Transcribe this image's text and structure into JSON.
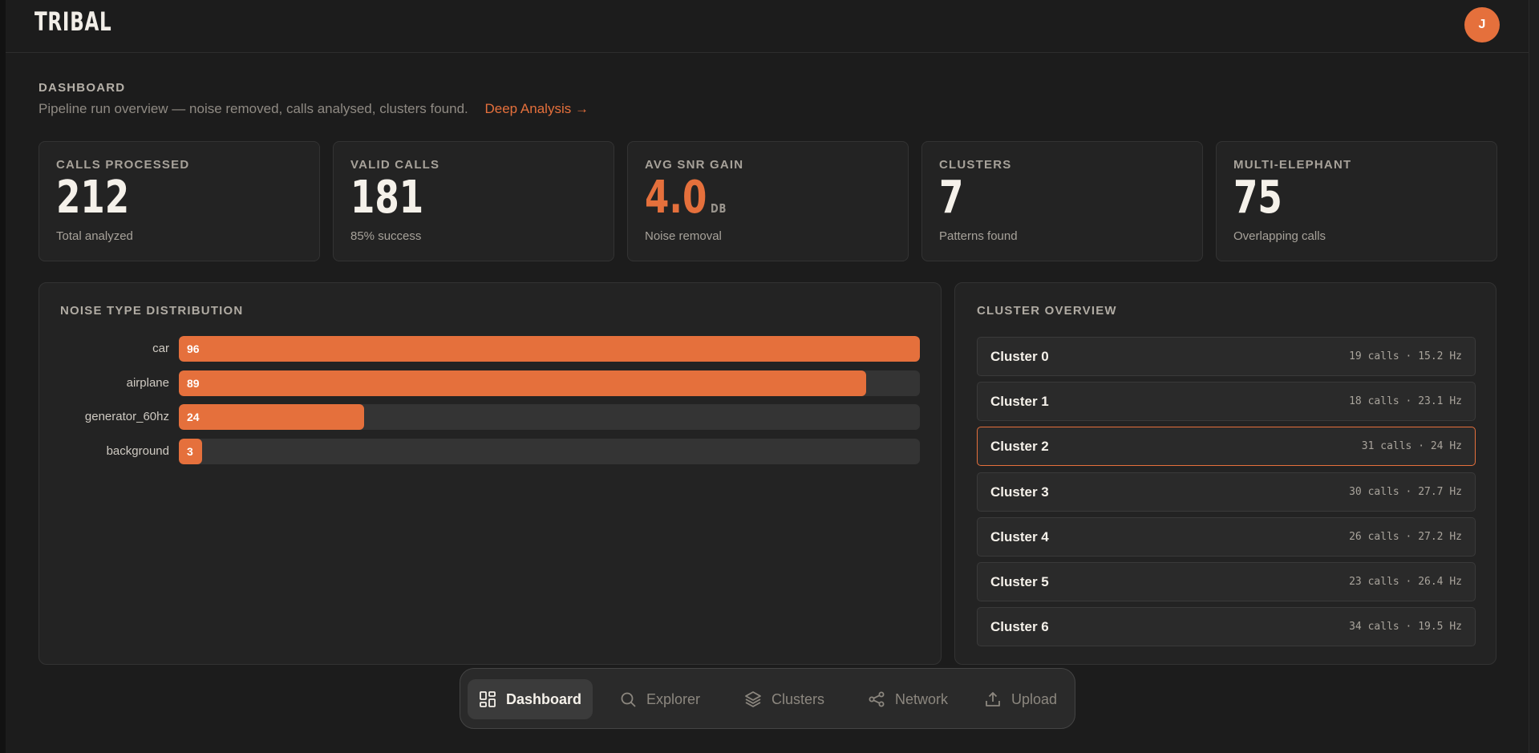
{
  "brand": {
    "name": "TRIBAL",
    "avatar_initial": "J"
  },
  "header": {
    "eyebrow": "DASHBOARD",
    "subtitle": "Pipeline run overview — noise removed, calls analysed, clusters found.",
    "deep_link": "Deep Analysis →"
  },
  "stats": [
    {
      "label": "CALLS PROCESSED",
      "value": "212",
      "unit": "",
      "caption": "Total analyzed"
    },
    {
      "label": "VALID CALLS",
      "value": "181",
      "unit": "",
      "caption": "85% success"
    },
    {
      "label": "AVG SNR GAIN",
      "value": "4.0",
      "unit": "DB",
      "caption": "Noise removal"
    },
    {
      "label": "CLUSTERS",
      "value": "7",
      "unit": "",
      "caption": "Patterns found"
    },
    {
      "label": "MULTI-ELEPHANT",
      "value": "75",
      "unit": "",
      "caption": "Overlapping calls"
    }
  ],
  "noise_panel": {
    "title": "NOISE TYPE DISTRIBUTION",
    "max": 96,
    "rows": [
      {
        "label": "car",
        "value": 96
      },
      {
        "label": "airplane",
        "value": 89
      },
      {
        "label": "generator_60hz",
        "value": 24
      },
      {
        "label": "background",
        "value": 3
      }
    ]
  },
  "cluster_panel": {
    "title": "CLUSTER OVERVIEW",
    "selected_index": 2,
    "items": [
      {
        "name": "Cluster 0",
        "meta": "19 calls · 15.2 Hz"
      },
      {
        "name": "Cluster 1",
        "meta": "18 calls · 23.1 Hz"
      },
      {
        "name": "Cluster 2",
        "meta": "31 calls · 24 Hz"
      },
      {
        "name": "Cluster 3",
        "meta": "30 calls · 27.7 Hz"
      },
      {
        "name": "Cluster 4",
        "meta": "26 calls · 27.2 Hz"
      },
      {
        "name": "Cluster 5",
        "meta": "23 calls · 26.4 Hz"
      },
      {
        "name": "Cluster 6",
        "meta": "34 calls · 19.5 Hz"
      }
    ]
  },
  "nav": {
    "active": "Dashboard",
    "items": [
      {
        "label": "Dashboard",
        "icon": "dashboard-grid-icon"
      },
      {
        "label": "Explorer",
        "icon": "search-icon"
      },
      {
        "label": "Clusters",
        "icon": "layers-icon"
      },
      {
        "label": "Network",
        "icon": "share-network-icon"
      },
      {
        "label": "Upload",
        "icon": "upload-icon"
      }
    ]
  },
  "colors": {
    "accent": "#e5703c",
    "background": "#1c1c1c",
    "card": "#232323"
  }
}
